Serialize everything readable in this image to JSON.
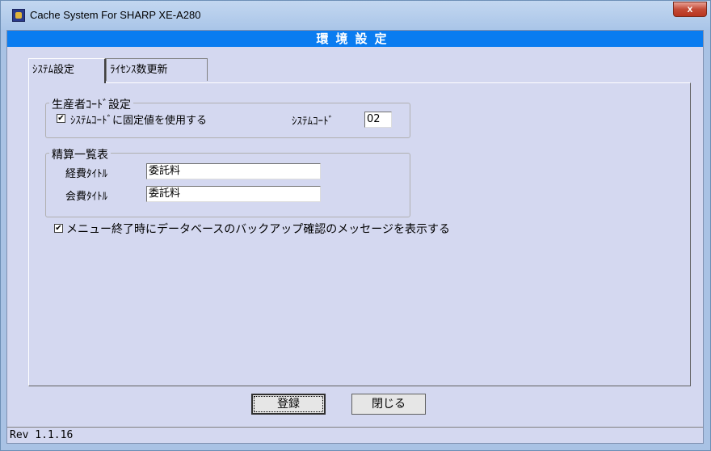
{
  "window": {
    "title": "Cache System For SHARP XE-A280",
    "close_label": "x"
  },
  "header": {
    "title": "環境設定"
  },
  "tabs": [
    {
      "label": "ｼｽﾃﾑ設定",
      "active": true
    },
    {
      "label": "ﾗｲｾﾝｽ数更新",
      "active": false
    }
  ],
  "producer_code": {
    "legend": "生産者ｺｰﾄﾞ設定",
    "use_fixed_label": "ｼｽﾃﾑｺｰﾄﾞに固定値を使用する",
    "use_fixed_checked": true,
    "system_code_label": "ｼｽﾃﾑｺｰﾄﾞ",
    "system_code_value": "02"
  },
  "settlement": {
    "legend": "精算一覧表",
    "expense_label": "経費ﾀｲﾄﾙ",
    "expense_value": "委託料",
    "fee_label": "会費ﾀｲﾄﾙ",
    "fee_value": "委託料"
  },
  "backup_confirm": {
    "label": "メニュー終了時にデータベースのバックアップ確認のメッセージを表示する",
    "checked": true
  },
  "buttons": {
    "register": "登録",
    "close": "閉じる"
  },
  "status": {
    "version": "Rev 1.1.16"
  },
  "colors": {
    "header_bar": "#0a7cf0",
    "close_button": "#c44a36",
    "panel_bg": "#d4d8f0"
  },
  "icons": {
    "app": "app-logo-icon",
    "close": "close-icon",
    "check": "checkmark-icon"
  }
}
